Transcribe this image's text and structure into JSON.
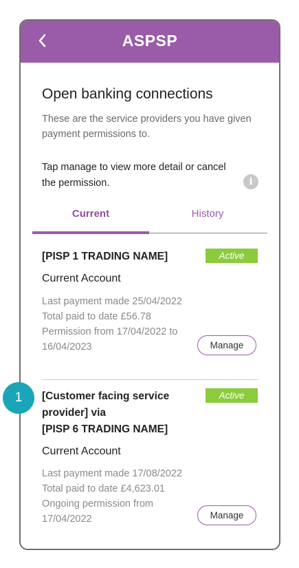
{
  "header": {
    "title": "ASPSP"
  },
  "page": {
    "title": "Open banking connections",
    "subtitle": "These are the service providers you have given payment permissions to.",
    "instruction": "Tap manage to view more detail or cancel the permission."
  },
  "tabs": [
    {
      "label": "Current",
      "active": true
    },
    {
      "label": "History",
      "active": false
    }
  ],
  "connections": [
    {
      "name": "[PISP 1 TRADING NAME]",
      "status": "Active",
      "account": "Current Account",
      "last_payment": "Last payment made 25/04/2022",
      "total_paid": "Total paid to date  £56.78",
      "permission_1": "Permission from 17/04/2022 to",
      "permission_2": "16/04/2023",
      "manage_label": "Manage"
    },
    {
      "name_1": "[Customer facing service",
      "name_2": "provider] via",
      "name_3": "[PISP 6 TRADING NAME]",
      "status": "Active",
      "account": "Current Account",
      "last_payment": "Last payment made 17/08/2022",
      "total_paid": "Total paid to date  £4,623.01",
      "permission_1": "Ongoing permission from",
      "permission_2": "17/04/2022",
      "manage_label": "Manage"
    }
  ],
  "annotation": {
    "marker": "1"
  },
  "colors": {
    "brand": "#9a5ba8",
    "active_badge": "#8ccc3c",
    "marker": "#1aa5b8"
  },
  "icons": {
    "back": "chevron-left-icon",
    "info": "info-icon"
  }
}
